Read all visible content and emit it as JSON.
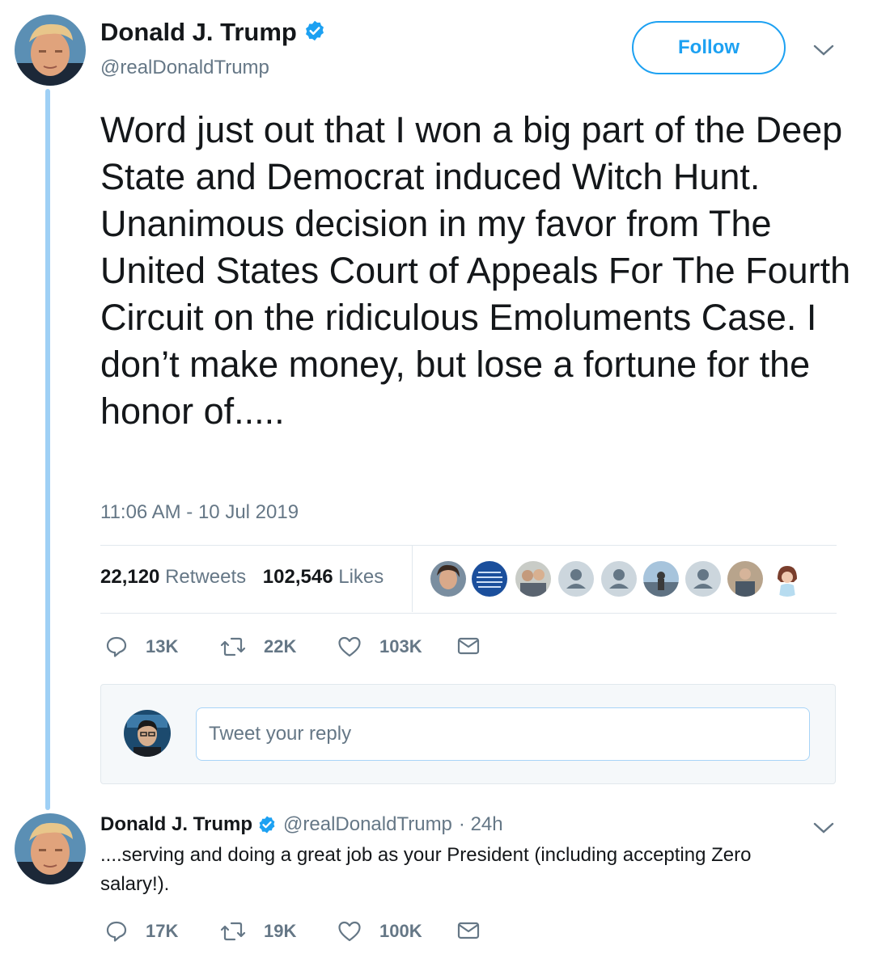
{
  "tweet": {
    "author_name": "Donald J. Trump",
    "author_handle": "@realDonaldTrump",
    "follow_label": "Follow",
    "text": "Word just out that I won a big part of the Deep State and Democrat induced Witch Hunt. Unanimous decision in my favor from The United States Court of Appeals For The Fourth Circuit on the ridiculous Emoluments Case. I don’t make money, but lose a fortune for the honor of.....",
    "timestamp": "11:06 AM - 10 Jul 2019",
    "retweets_count": "22,120",
    "retweets_label": "Retweets",
    "likes_count": "102,546",
    "likes_label": "Likes",
    "actions": {
      "reply": "13K",
      "retweet": "22K",
      "like": "103K"
    },
    "reply_placeholder": "Tweet your reply"
  },
  "thread_tweet": {
    "author_name": "Donald J. Trump",
    "author_handle": "@realDonaldTrump",
    "time": "· 24h",
    "text": "....serving and doing a great job as your President (including accepting Zero salary!).",
    "actions": {
      "reply": "17K",
      "retweet": "19K",
      "like": "100K"
    }
  },
  "colors": {
    "accent": "#1da1f2",
    "thread_line": "#9fd0f5",
    "secondary_text": "#657786",
    "border": "#e1e8ed"
  }
}
